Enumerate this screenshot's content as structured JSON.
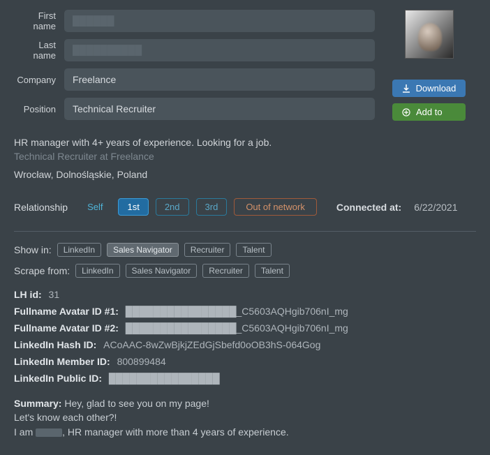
{
  "fields": {
    "first_name_label": "First name",
    "first_name_value": "██████",
    "last_name_label": "Last name",
    "last_name_value": "██████████",
    "company_label": "Company",
    "company_value": "Freelance",
    "position_label": "Position",
    "position_value": "Technical Recruiter"
  },
  "actions": {
    "download_label": "Download",
    "add_to_label": "Add to"
  },
  "description": {
    "main": "HR manager with 4+ years of experience. Looking for a job.",
    "sub": "Technical Recruiter at Freelance",
    "location": "Wrocław, Dolnośląskie, Poland"
  },
  "relationship": {
    "label": "Relationship",
    "options": {
      "self": "Self",
      "first": "1st",
      "second": "2nd",
      "third": "3rd",
      "out": "Out of network"
    },
    "connected_label": "Connected at:",
    "connected_date": "6/22/2021"
  },
  "show_in": {
    "label": "Show in:",
    "linkedin": "LinkedIn",
    "sales_nav": "Sales Navigator",
    "recruiter": "Recruiter",
    "talent": "Talent"
  },
  "scrape_from": {
    "label": "Scrape from:",
    "linkedin": "LinkedIn",
    "sales_nav": "Sales Navigator",
    "recruiter": "Recruiter",
    "talent": "Talent"
  },
  "ids": {
    "lh_id_label": "LH id:",
    "lh_id_value": "31",
    "avatar1_label": "Fullname Avatar ID #1:",
    "avatar1_value": "████████████████_C5603AQHgib706nI_mg",
    "avatar2_label": "Fullname Avatar ID #2:",
    "avatar2_value": "████████████████_C5603AQHgib706nI_mg",
    "hash_label": "LinkedIn Hash ID:",
    "hash_value": "ACoAAC-8wZwBjkjZEdGjSbefd0oOB3hS-064Gog",
    "member_label": "LinkedIn Member ID:",
    "member_value": "800899484",
    "public_label": "LinkedIn Public ID:",
    "public_value": "████████████████"
  },
  "summary": {
    "label": "Summary:",
    "line1": "Hey, glad to see you on my page!",
    "line2": "Let's know each other?!",
    "line3_a": "I am ",
    "line3_redacted": "█████",
    "line3_b": ", HR manager with more than 4 years of experience."
  }
}
